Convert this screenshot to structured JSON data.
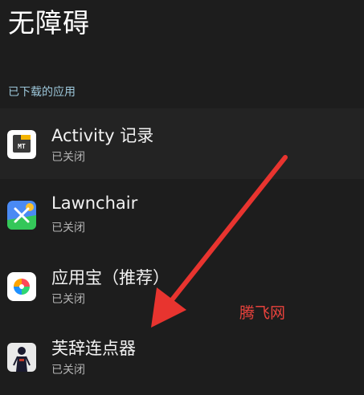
{
  "header": {
    "title": "无障碍"
  },
  "section": {
    "label": "已下载的应用"
  },
  "apps": [
    {
      "name": "Activity 记录",
      "status": "已关闭",
      "icon": "activity-log-app-icon"
    },
    {
      "name": "Lawnchair",
      "status": "已关闭",
      "icon": "lawnchair-app-icon"
    },
    {
      "name": "应用宝（推荐）",
      "status": "已关闭",
      "icon": "yingyongbao-app-icon"
    },
    {
      "name": "芙辞连点器",
      "status": "已关闭",
      "icon": "fuci-clicker-app-icon"
    }
  ],
  "overlay": {
    "watermark": "腾飞网",
    "arrow_color": "#e8342f"
  }
}
